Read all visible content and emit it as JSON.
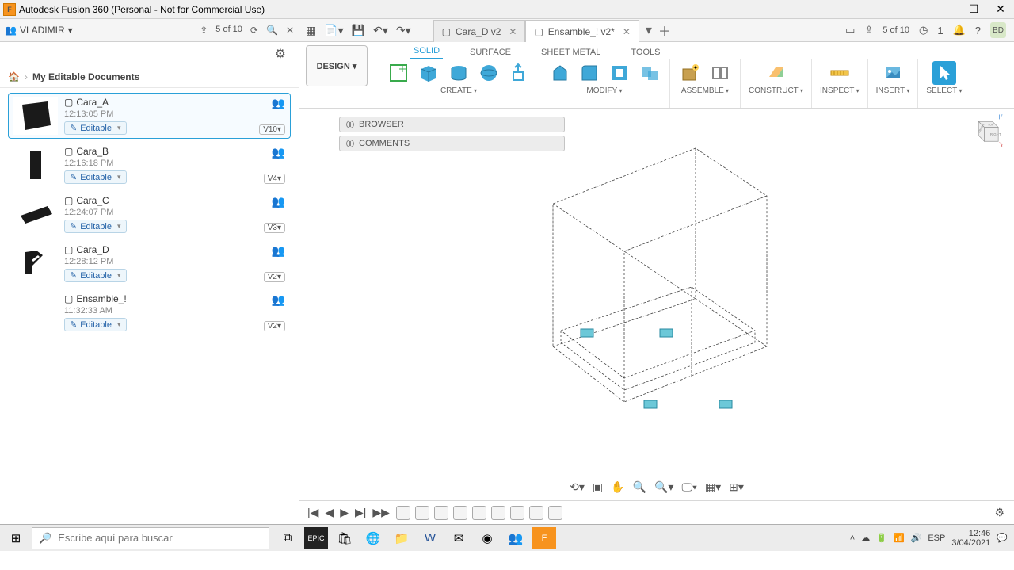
{
  "window": {
    "title": "Autodesk Fusion 360 (Personal - Not for Commercial Use)"
  },
  "team": {
    "name": "VLADIMIR",
    "files_badge": "5 of 10"
  },
  "tabs": [
    {
      "label": "Cara_D v2",
      "active": false
    },
    {
      "label": "Ensamble_! v2*",
      "active": true
    }
  ],
  "topstatus": {
    "files": "5 of 10",
    "jobs": "1",
    "avatar": "BD"
  },
  "breadcrumb": {
    "current": "My Editable Documents"
  },
  "documents": [
    {
      "name": "Cara_A",
      "time": "12:13:05 PM",
      "state": "Editable",
      "version": "V10▾",
      "selected": true
    },
    {
      "name": "Cara_B",
      "time": "12:16:18 PM",
      "state": "Editable",
      "version": "V4▾",
      "selected": false
    },
    {
      "name": "Cara_C",
      "time": "12:24:07 PM",
      "state": "Editable",
      "version": "V3▾",
      "selected": false
    },
    {
      "name": "Cara_D",
      "time": "12:28:12 PM",
      "state": "Editable",
      "version": "V2▾",
      "selected": false
    },
    {
      "name": "Ensamble_!",
      "time": "11:32:33 AM",
      "state": "Editable",
      "version": "V2▾",
      "selected": false
    }
  ],
  "ribbon": {
    "design_label": "DESIGN ▾",
    "tabs": [
      "SOLID",
      "SURFACE",
      "SHEET METAL",
      "TOOLS"
    ],
    "active_tab": "SOLID",
    "groups": {
      "create": "CREATE",
      "modify": "MODIFY",
      "assemble": "ASSEMBLE",
      "construct": "CONSTRUCT",
      "inspect": "INSPECT",
      "insert": "INSERT",
      "select": "SELECT"
    }
  },
  "panels": {
    "browser": "BROWSER",
    "comments": "COMMENTS"
  },
  "taskbar": {
    "search_placeholder": "Escribe aquí para buscar",
    "lang": "ESP",
    "time": "12:46",
    "date": "3/04/2021"
  }
}
